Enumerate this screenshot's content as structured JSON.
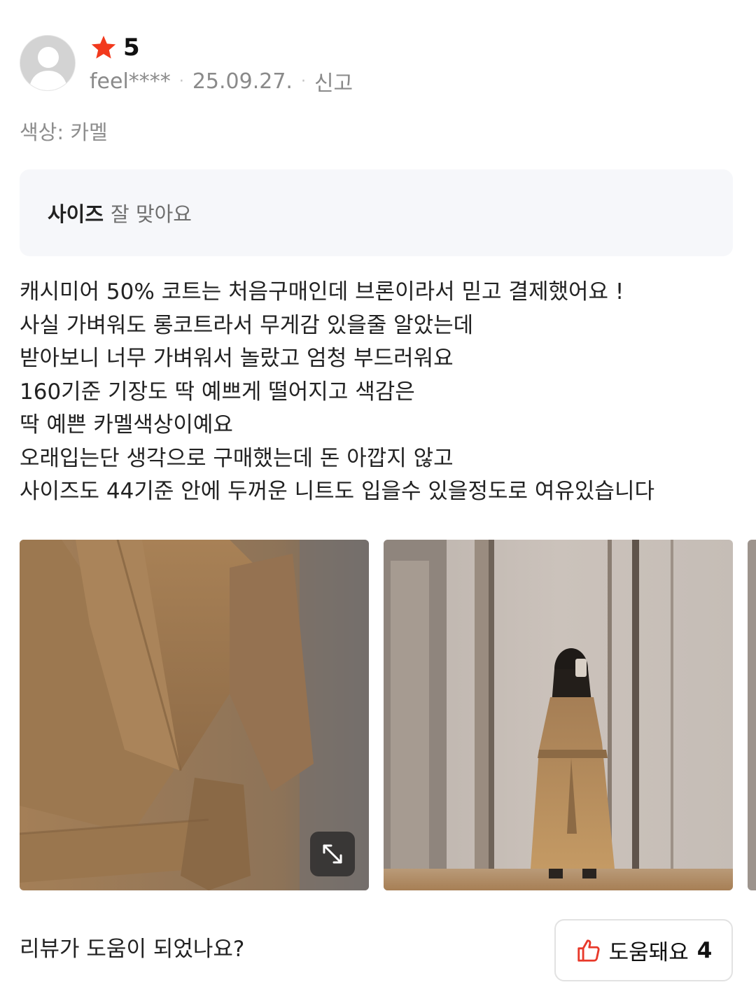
{
  "review": {
    "rating": "5",
    "user": "feel****",
    "separator": "·",
    "date": "25.09.27.",
    "report_label": "신고",
    "option_label": "색상:",
    "option_value": "카멜",
    "size_key": "사이즈",
    "size_value": "잘 맞아요",
    "body_lines": [
      "캐시미어 50% 코트는 처음구매인데 브론이라서 믿고 결제했어요 !",
      "사실 가벼워도 롱코트라서 무게감 있을줄 알았는데",
      "받아보니 너무 가벼워서 놀랐고 엄청 부드러워요",
      "160기준 기장도 딱 예쁘게 떨어지고 색감은",
      "딱 예쁜 카멜색상이예요",
      "오래입는단 생각으로 구매했는데 돈 아깝지 않고",
      "사이즈도 44기준 안에 두꺼운 니트도 입을수 있을정도로 여유있습니다"
    ]
  },
  "photos": [
    {
      "name": "coat-closeup-photo",
      "has_expand": true
    },
    {
      "name": "mirror-selfie-photo",
      "has_expand": false
    },
    {
      "name": "third-photo-peek",
      "has_expand": false
    }
  ],
  "footer": {
    "question": "리뷰가 도움이 되었나요?",
    "helpful_label": "도움돼요",
    "helpful_count": "4"
  },
  "colors": {
    "star": "#f2391d",
    "helpful_icon": "#e8392a",
    "size_box_bg": "#f6f7fa",
    "meta_gray": "#8a8a8a"
  },
  "icons": {
    "avatar": "user-silhouette-icon",
    "star": "star-icon",
    "expand": "expand-icon",
    "helpful": "thumbs-up-icon"
  }
}
